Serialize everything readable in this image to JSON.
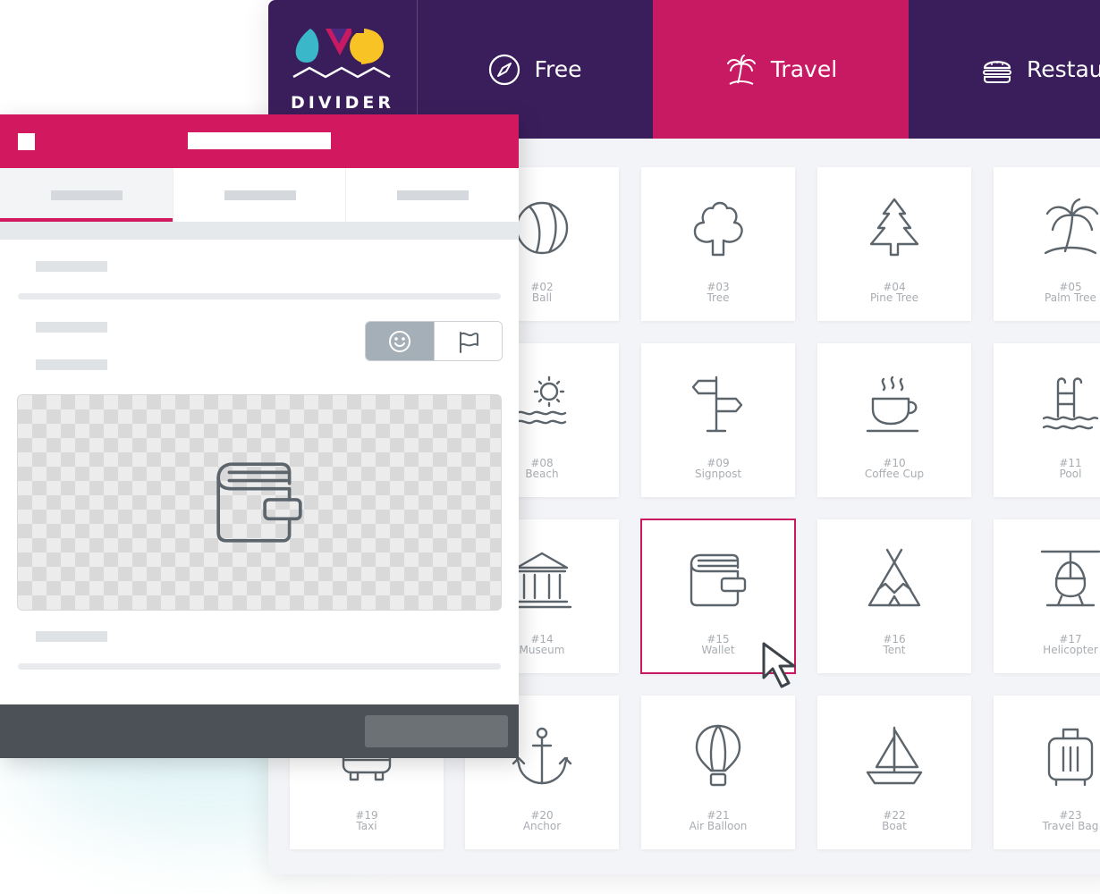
{
  "brand": {
    "logo_text": "DIVIDER"
  },
  "category_tabs": [
    {
      "label": "Free",
      "icon": "compass-icon"
    },
    {
      "label": "Travel",
      "icon": "palm-tree-icon",
      "active": true
    },
    {
      "label": "Restau",
      "icon": "burger-icon"
    }
  ],
  "icons": [
    {
      "number": "#02",
      "name": "Ball",
      "icon": "ball-icon"
    },
    {
      "number": "#03",
      "name": "Tree",
      "icon": "tree-icon"
    },
    {
      "number": "#04",
      "name": "Pine Tree",
      "icon": "pine-tree-icon"
    },
    {
      "number": "#05",
      "name": "Palm Tree",
      "icon": "palm-tree-icon"
    },
    {
      "number": "#08",
      "name": "Beach",
      "icon": "beach-icon"
    },
    {
      "number": "#09",
      "name": "Signpost",
      "icon": "signpost-icon"
    },
    {
      "number": "#10",
      "name": "Coffee Cup",
      "icon": "coffee-cup-icon"
    },
    {
      "number": "#11",
      "name": "Pool",
      "icon": "pool-icon"
    },
    {
      "number": "#14",
      "name": "Museum",
      "icon": "museum-icon"
    },
    {
      "number": "#15",
      "name": "Wallet",
      "icon": "wallet-icon",
      "selected": true
    },
    {
      "number": "#16",
      "name": "Tent",
      "icon": "tent-icon"
    },
    {
      "number": "#17",
      "name": "Helicopter",
      "icon": "helicopter-icon"
    },
    {
      "number": "#19",
      "name": "Taxi",
      "icon": "taxi-icon"
    },
    {
      "number": "#20",
      "name": "Anchor",
      "icon": "anchor-icon"
    },
    {
      "number": "#21",
      "name": "Air Balloon",
      "icon": "air-balloon-icon"
    },
    {
      "number": "#22",
      "name": "Boat",
      "icon": "boat-icon"
    },
    {
      "number": "#23",
      "name": "Travel Bag",
      "icon": "travel-bag-icon"
    }
  ],
  "editor": {
    "preview_icon": "wallet-icon",
    "toggle_options": [
      {
        "icon": "smiley-icon",
        "selected": true
      },
      {
        "icon": "flag-icon",
        "selected": false
      }
    ]
  },
  "colors": {
    "brand_purple": "#3a1e5c",
    "accent_pink": "#c81a62",
    "icon_stroke": "#5d656c",
    "label_gray": "#a8adb2",
    "footer": "#4b5157"
  }
}
